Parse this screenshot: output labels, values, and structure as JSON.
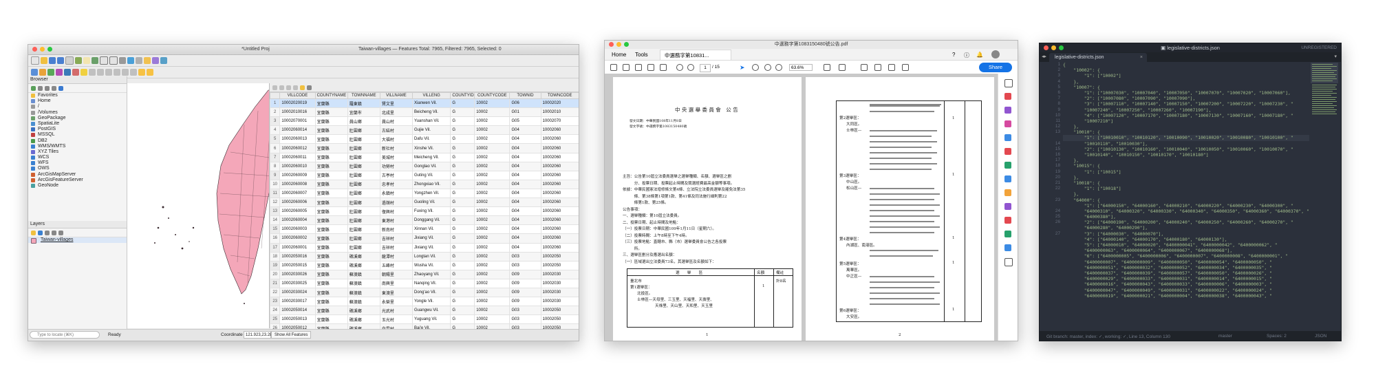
{
  "qgis": {
    "title": "*Untitled Proj",
    "title_right": "Taiwan-villages — Features Total: 7965, Filtered: 7965, Selected: 0",
    "browser": {
      "header": "Browser",
      "items": [
        "Favorites",
        "Home",
        "/",
        "/Volumes",
        "GeoPackage",
        "SpatiaLite",
        "PostGIS",
        "MSSQL",
        "DB2",
        "WMS/WMTS",
        "XYZ Tiles",
        "WCS",
        "WFS",
        "OWS",
        "ArcGisMapServer",
        "ArcGisFeatureServer",
        "GeoNode"
      ]
    },
    "layers": {
      "header": "Layers",
      "layer_name": "Taiwan-villages"
    },
    "table": {
      "columns": [
        "VILLCODE",
        "COUNTYNAME",
        "TOWNNAME",
        "VILLNAME",
        "VILLENG",
        "COUNTYID",
        "COUNTYCODE",
        "TOWNID",
        "TOWNCODE"
      ],
      "rows": [
        [
          "1",
          "10002020019",
          "宜蘭縣",
          "羅東鎮",
          "賢文里",
          "Xianwen Vil.",
          "G",
          "10002",
          "G06",
          "10002020"
        ],
        [
          "2",
          "10002010016",
          "宜蘭縣",
          "宜蘭市",
          "北成里",
          "Beicheng Vil.",
          "G",
          "10002",
          "G01",
          "10002010"
        ],
        [
          "3",
          "10002070001",
          "宜蘭縣",
          "員山鄉",
          "員山村",
          "Yuanshan Vil.",
          "G",
          "10002",
          "G05",
          "10002070"
        ],
        [
          "4",
          "10002060014",
          "宜蘭縣",
          "壯圍鄉",
          "古結村",
          "Gujie Vil.",
          "G",
          "10002",
          "G04",
          "10002060"
        ],
        [
          "5",
          "10002060013",
          "宜蘭縣",
          "壯圍鄉",
          "大福村",
          "Dafu Vil.",
          "G",
          "10002",
          "G04",
          "10002060"
        ],
        [
          "6",
          "10002060012",
          "宜蘭縣",
          "壯圍鄉",
          "新社村",
          "Xinshe Vil.",
          "G",
          "10002",
          "G04",
          "10002060"
        ],
        [
          "7",
          "10002060011",
          "宜蘭縣",
          "壯圍鄉",
          "美城村",
          "Meicheng Vil.",
          "G",
          "10002",
          "G04",
          "10002060"
        ],
        [
          "8",
          "10002060010",
          "宜蘭縣",
          "壯圍鄉",
          "功勞村",
          "Gonglao Vil.",
          "G",
          "10002",
          "G04",
          "10002060"
        ],
        [
          "9",
          "10002060009",
          "宜蘭縣",
          "壯圍鄉",
          "古亭村",
          "Guting Vil.",
          "G",
          "10002",
          "G04",
          "10002060"
        ],
        [
          "10",
          "10002060008",
          "宜蘭縣",
          "壯圍鄉",
          "忠孝村",
          "Zhongxiao Vil.",
          "G",
          "10002",
          "G04",
          "10002060"
        ],
        [
          "11",
          "10002060007",
          "宜蘭縣",
          "壯圍鄉",
          "永鎮村",
          "Yongzhen Vil.",
          "G",
          "10002",
          "G04",
          "10002060"
        ],
        [
          "12",
          "10002060006",
          "宜蘭縣",
          "壯圍鄉",
          "過嶺村",
          "Guoling Vil.",
          "G",
          "10002",
          "G04",
          "10002060"
        ],
        [
          "13",
          "10002060005",
          "宜蘭縣",
          "壯圍鄉",
          "復興村",
          "Fuxing Vil.",
          "G",
          "10002",
          "G04",
          "10002060"
        ],
        [
          "14",
          "10002060004",
          "宜蘭縣",
          "壯圍鄉",
          "東港村",
          "Donggang Vil.",
          "G",
          "10002",
          "G04",
          "10002060"
        ],
        [
          "15",
          "10002060003",
          "宜蘭縣",
          "壯圍鄉",
          "新南村",
          "Xinnan Vil.",
          "G",
          "10002",
          "G04",
          "10002060"
        ],
        [
          "16",
          "10002060002",
          "宜蘭縣",
          "壯圍鄉",
          "吉祥村",
          "Jixiang Vil.",
          "G",
          "10002",
          "G04",
          "10002060"
        ],
        [
          "17",
          "10002060001",
          "宜蘭縣",
          "壯圍鄉",
          "吉祥村",
          "Jixiang Vil.",
          "G",
          "10002",
          "G04",
          "10002060"
        ],
        [
          "18",
          "10002050016",
          "宜蘭縣",
          "礁溪鄉",
          "龍潭村",
          "Longtan Vil.",
          "G",
          "10002",
          "G03",
          "10002050"
        ],
        [
          "19",
          "10002050015",
          "宜蘭縣",
          "礁溪鄉",
          "五峰村",
          "Wusha Vil.",
          "G",
          "10002",
          "G03",
          "10002050"
        ],
        [
          "20",
          "10002030026",
          "宜蘭縣",
          "蘇澳鎮",
          "朝陽里",
          "Zhaoyang Vil.",
          "G",
          "10002",
          "G09",
          "10002030"
        ],
        [
          "21",
          "10002030025",
          "宜蘭縣",
          "蘇澳鎮",
          "南興里",
          "Nanqing Vil.",
          "G",
          "10002",
          "G09",
          "10002030"
        ],
        [
          "22",
          "10002030024",
          "宜蘭縣",
          "蘇澳鎮",
          "東澳里",
          "Dong'ao Vil.",
          "G",
          "10002",
          "G09",
          "10002030"
        ],
        [
          "23",
          "10002030017",
          "宜蘭縣",
          "蘇澳鎮",
          "永榮里",
          "Yongle Vil.",
          "G",
          "10002",
          "G09",
          "10002030"
        ],
        [
          "24",
          "10002050014",
          "宜蘭縣",
          "礁溪鄉",
          "光武村",
          "Guangwu Vil.",
          "G",
          "10002",
          "G03",
          "10002050"
        ],
        [
          "25",
          "10002050013",
          "宜蘭縣",
          "礁溪鄉",
          "玉光村",
          "Yuguang Vil.",
          "G",
          "10002",
          "G03",
          "10002050"
        ],
        [
          "26",
          "10002050012",
          "宜蘭縣",
          "礁溪鄉",
          "白雲村",
          "Bai'e Vil.",
          "G",
          "10002",
          "G03",
          "10002050"
        ]
      ]
    },
    "status": {
      "locator_placeholder": "Type to locate (⌘K)",
      "ready": "Ready",
      "coordinate_label": "Coordinate",
      "coordinate_value": "121.923,23.28",
      "show_all": "Show All Features"
    }
  },
  "pdf": {
    "title": "中選務字第1083150480號公告.pdf",
    "nav": {
      "home": "Home",
      "tools": "Tools",
      "tab": "中選務字第10831..."
    },
    "page_num": "1",
    "page_total": "/ 15",
    "zoom": "63.6%",
    "share_label": "Share",
    "page1": {
      "heading": "中 央 選 舉 委 員 會　公 告",
      "meta": [
        "發文日期：中華民國108年11月8日",
        "發文字號：中選務字第1083150480號"
      ],
      "lines": [
        "主旨：公告第10屆立法委員選舉之選舉種類、名額、選舉區之劃",
        "　　　分、投票日期、投票起止時間及競選經費最高金額等事項。",
        "依據：中華民國憲法增修條文第4條、立法院立法委員選舉及罷免法第35",
        "　　　條、第38條第1項第1款、第41條及同法施行細則第22",
        "　　　條第1款、第25條。",
        "公告事項：",
        "一、選舉種類：第10屆立法委員。",
        "二、投票日期、起止時間及地點：",
        "（一）投票日期：中華民國109年1月11日（星期六）。",
        "（二）投票時間：上午8時至下午4時。",
        "（三）投票地點：直轄市、縣（市）選舉委員會公告之各投票",
        "　　　所。",
        "三、選舉區劃分及應選出名額：",
        "（一）區域選出立法委員73名，其選舉區及名額如下："
      ],
      "table_headers": [
        "選　　舉　　區",
        "名額",
        "備註"
      ],
      "table_rows": [
        "臺北市",
        "第1選舉區：",
        "北投區。",
        "士林區—天母里、三玉里、天福里、天壽里、",
        "天祿里、天山里、天和里、天玉里"
      ],
      "seat": "1",
      "remark": "計8名",
      "page_no": "1"
    },
    "page2": {
      "district_labels": [
        "第2選舉區：",
        "大同區。",
        "士林區—",
        "第3選舉區：",
        "中山區。",
        "松山區—",
        "第4選舉區：",
        "內湖區、南港區。",
        "第5選舉區：",
        "萬華區。",
        "中正區—",
        "第6選舉區：",
        "大安區。"
      ],
      "seat_values": [
        "1",
        "1",
        "1",
        "1",
        "1"
      ],
      "page_no": "2"
    }
  },
  "sublime": {
    "title": "legislative-districts.json",
    "unregistered": "UNREGISTERED",
    "tab": "legislative-districts.json",
    "line_numbers": [
      "1",
      "2",
      "3",
      "4",
      "5",
      "6",
      "7",
      "8",
      "9",
      "10",
      "11",
      "12",
      "13",
      "",
      "14",
      "15",
      "16",
      "17",
      "18",
      "19",
      "20",
      "21",
      "22",
      "",
      "23",
      "",
      "24",
      "25",
      "26",
      "",
      "27",
      "",
      "",
      "",
      "",
      "",
      "",
      "",
      "",
      "",
      "",
      ""
    ],
    "code_lines": [
      "{",
      "    \"10002\": {",
      "        \"1\": [\"10002\"]",
      "    },",
      "    \"10007\": {",
      "        \"1\": [\"10007030\", \"10007040\", \"10007050\", \"10007070\", \"10007020\", \"10007060\"],",
      "        \"2\": [\"10007080\", \"10007090\", \"10007090\"],",
      "        \"3\": [\"10007110\", \"10007140\", \"10007150\", \"10007200\", \"10007220\", \"10007230\", \"",
      "        \"10007240\", \"10007250\", \"10007260\", \"10007190\"],",
      "        \"4\": [\"10007120\", \"10007170\", \"10007180\", \"10007130\", \"10007160\", \"10007180\", \"",
      "        \"10007210\"]",
      "    },",
      "    \"10010\": {",
      "        \"1\": [\"10010010\", \"10010120\", \"10010090\", \"10010020\", \"10010080\", \"10010100\", \"",
      "        \"10010110\", \"10010030\"],",
      "        \"2\": [\"10010130\", \"10010160\", \"10010040\", \"10010050\", \"10010060\", \"10010070\", \"",
      "        \"10010140\", \"10010150\", \"10010170\", \"10010180\"]",
      "    },",
      "    \"10015\": {",
      "        \"1\": [\"10015\"]",
      "    },",
      "    \"10018\": {",
      "        \"1\": [\"10018\"]",
      "    },",
      "    \"64000\": {",
      "        \"1\": [\"64000150\", \"64000160\", \"64000210\", \"64000220\", \"64000230\", \"64000300\", \"",
      "        \"64000310\", \"64000320\", \"64000330\", \"64000340\", \"64000350\", \"64000360\", \"64000370\", \"",
      "        \"64000380\"],",
      "        \"2\": [\"64000190\", \"64000200\", \"64000240\", \"64000250\", \"64000260\", \"64000270\", \"",
      "        \"64000280\", \"64000290\"],",
      "        \"3\": [\"64000030\", \"64000070\"],",
      "        \"4\": [\"64000140\", \"64000170\", \"64000180\", \"64000130\"],",
      "        \"5\": [\"64000010\", \"64000020\", \"6400000041\", \"6400000042\", \"6400000062\", \"",
      "        \"6400000063\", \"6400000064\", \"6400000067\", \"6400000068\"],",
      "        \"6\": [\"6400000005\", \"6400000006\", \"6400000007\", \"6400000008\", \"6400000001\", \"",
      "        \"6400000007\", \"6400000009\", \"6400000050\", \"6400000054\", \"6400000050\", \"",
      "        \"6400000051\", \"6400000032\", \"6400000052\", \"6400000034\", \"6400000035\", \"",
      "        \"6400000037\", \"6400000039\", \"6400000057\", \"6400000050\", \"6400000026\", \"",
      "        \"6400000029\", \"6400000033\", \"6400000031\", \"6400000014\", \"6400000015\", \"",
      "        \"6400000016\", \"6400000043\", \"6400000033\", \"6400000006\", \"6400000003\", \"",
      "        \"6400000047\", \"6400000049\", \"6400000031\", \"6400000022\", \"6400000024\", \"",
      "        \"6400000019\", \"6400000021\", \"6400000004\", \"6400000038\", \"6400000043\", \""
    ],
    "status": {
      "left": "Git branch: master, index: ✓, working: ✓, Line 13, Column 130",
      "branch": "master",
      "spaces": "Spaces: 2",
      "syntax": "JSON"
    }
  },
  "colors": {
    "map_fill": "#f4a7b9",
    "accent": "#1473e6",
    "editor_bg": "#2b303b"
  }
}
